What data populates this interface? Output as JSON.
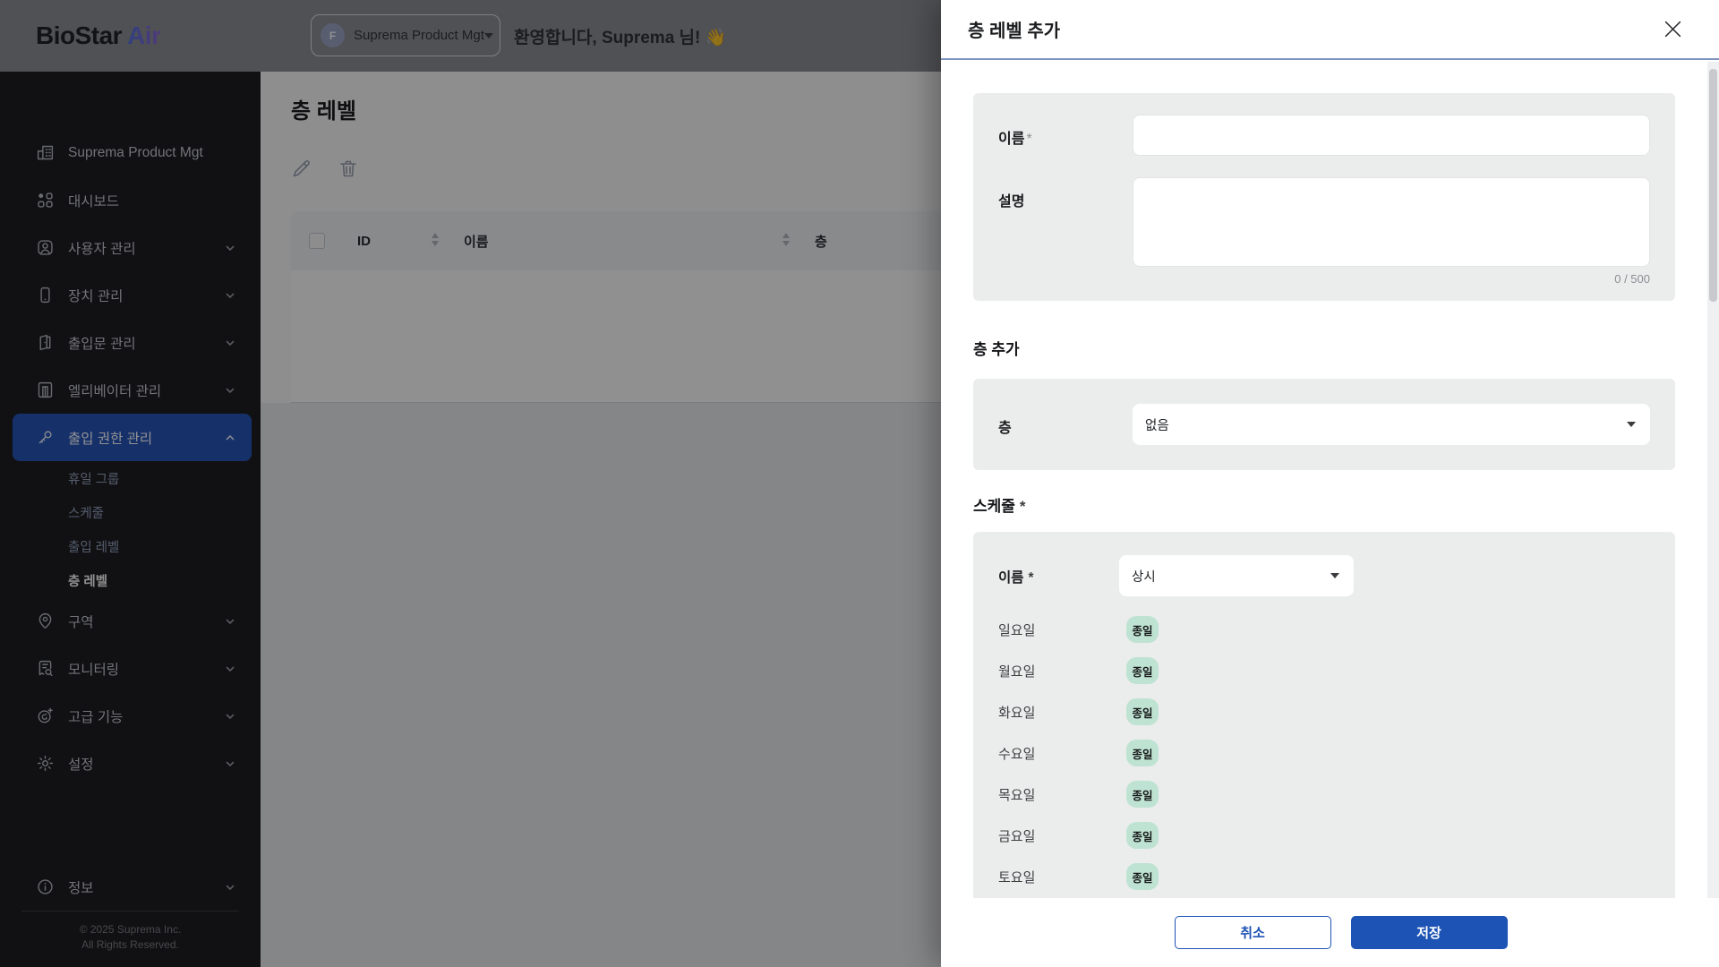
{
  "topbar": {
    "logo_primary": "BioStar",
    "logo_accent": "Air",
    "tenant": {
      "initial": "F",
      "name": "Suprema Product Mgt"
    },
    "welcome": "환영합니다, Suprema 님! 👋"
  },
  "sidebar": {
    "items": [
      {
        "label": "Suprema Product Mgt"
      },
      {
        "label": "대시보드"
      },
      {
        "label": "사용자 관리"
      },
      {
        "label": "장치 관리"
      },
      {
        "label": "출입문 관리"
      },
      {
        "label": "엘리베이터 관리"
      },
      {
        "label": "출입 권한 관리"
      },
      {
        "label": "구역"
      },
      {
        "label": "모니터링"
      },
      {
        "label": "고급 기능"
      },
      {
        "label": "설정"
      }
    ],
    "subitems": [
      {
        "label": "휴일 그룹"
      },
      {
        "label": "스케줄"
      },
      {
        "label": "출입 레벨"
      },
      {
        "label": "층 레벨"
      }
    ],
    "info_label": "정보",
    "copyright1": "© 2025 Suprema Inc.",
    "copyright2": "All Rights Reserved."
  },
  "main": {
    "title": "층 레벨",
    "table": {
      "col_id": "ID",
      "col_name": "이름",
      "col_floor": "층"
    }
  },
  "drawer": {
    "title": "층 레벨 추가",
    "name_label": "이름",
    "name_required": "*",
    "desc_label": "설명",
    "desc_counter": "0 / 500",
    "floor_heading": "층 추가",
    "floor_label": "층",
    "floor_value": "없음",
    "schedule_heading": "스케줄",
    "schedule_required": "*",
    "schedule_name_label": "이름",
    "schedule_name_required": "*",
    "schedule_value": "상시",
    "days": [
      {
        "label": "일요일",
        "badge": "종일"
      },
      {
        "label": "월요일",
        "badge": "종일"
      },
      {
        "label": "화요일",
        "badge": "종일"
      },
      {
        "label": "수요일",
        "badge": "종일"
      },
      {
        "label": "목요일",
        "badge": "종일"
      },
      {
        "label": "금요일",
        "badge": "종일"
      },
      {
        "label": "토요일",
        "badge": "종일"
      }
    ],
    "cancel_label": "취소",
    "save_label": "저장"
  },
  "colors": {
    "accent": "#1d53b4",
    "badge_bg": "#bfe3d2",
    "header_divider": "#7e93bd",
    "sidebar_bg": "#18181a"
  }
}
